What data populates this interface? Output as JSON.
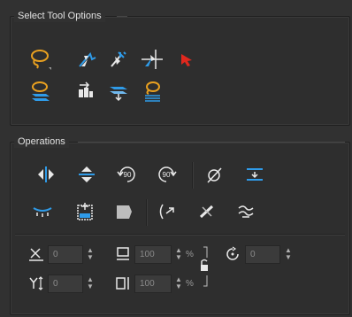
{
  "select_tool_options": {
    "title": "Select Tool Options",
    "row1": [
      {
        "icon": "lasso-select-icon"
      },
      {
        "icon": "contour-select-icon"
      },
      {
        "icon": "envelope-select-icon"
      },
      {
        "icon": "transform-select-icon"
      },
      {
        "icon": "red-arrow-select-icon"
      }
    ],
    "row2": [
      {
        "icon": "select-all-layers-icon"
      },
      {
        "icon": "apply-to-all-drawings-icon"
      },
      {
        "icon": "flatten-layers-icon"
      },
      {
        "icon": "snap-lasso-icon"
      }
    ]
  },
  "operations": {
    "title": "Operations",
    "row1": [
      {
        "icon": "flip-horizontal-icon"
      },
      {
        "icon": "flip-vertical-icon"
      },
      {
        "icon": "rotate-90-cw-icon",
        "text": "90"
      },
      {
        "icon": "rotate-90-ccw-icon",
        "text": "90"
      },
      {
        "icon": "hide-pivot-icon"
      },
      {
        "icon": "align-vertical-icon"
      }
    ],
    "row2": [
      {
        "icon": "distribute-icon"
      },
      {
        "icon": "create-layer-icon"
      },
      {
        "icon": "fill-shape-icon"
      },
      {
        "icon": "reverse-stroke-icon"
      },
      {
        "icon": "remove-stroke-icon"
      },
      {
        "icon": "smooth-stroke-icon"
      }
    ],
    "fields": {
      "x": {
        "value": "0",
        "icon": "x-position-icon"
      },
      "y": {
        "value": "0",
        "icon": "y-position-icon"
      },
      "width": {
        "value": "100",
        "icon": "width-icon",
        "unit": "%"
      },
      "height": {
        "value": "100",
        "icon": "height-icon",
        "unit": "%"
      },
      "angle": {
        "value": "0",
        "icon": "rotation-angle-icon"
      },
      "lock": {
        "icon": "lock-ratio-icon"
      }
    }
  },
  "colors": {
    "accent_blue": "#2f9be8",
    "icon_white": "#e8e8e8",
    "lasso_orange": "#e8a020",
    "red_arrow": "#e0281e"
  }
}
